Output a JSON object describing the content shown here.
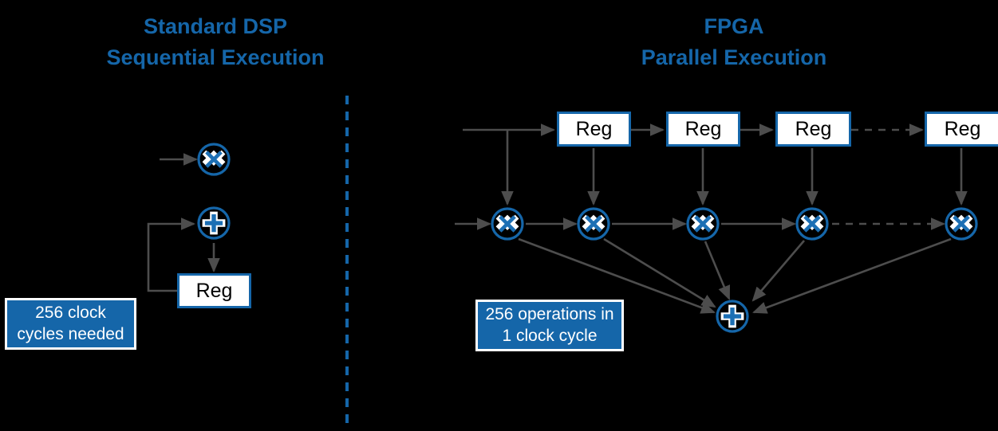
{
  "page": {
    "background": "#000000",
    "accent_blue": "#1566A9",
    "line_gray": "#4D4D4D",
    "box_fill": "#FFFFFF"
  },
  "left_panel": {
    "title_line1": "Standard DSP",
    "title_line2": "Sequential Execution",
    "register_label": "Reg",
    "callout_line1": "256 clock",
    "callout_line2": "cycles needed",
    "operators": [
      {
        "name": "multiply-operator",
        "symbol": "x"
      },
      {
        "name": "add-operator",
        "symbol": "+"
      }
    ]
  },
  "right_panel": {
    "title_line1": "FPGA",
    "title_line2": "Parallel Execution",
    "callout_line1": "256 operations in",
    "callout_line2": "1 clock cycle",
    "registers": [
      {
        "label": "Reg"
      },
      {
        "label": "Reg"
      },
      {
        "label": "Reg"
      },
      {
        "label": "Reg"
      }
    ],
    "multipliers": [
      {
        "symbol": "x"
      },
      {
        "symbol": "x"
      },
      {
        "symbol": "x"
      },
      {
        "symbol": "x"
      },
      {
        "symbol": "x"
      }
    ],
    "adder": {
      "symbol": "+"
    }
  },
  "divider": {
    "style": "dashed",
    "color": "#1566A9"
  }
}
